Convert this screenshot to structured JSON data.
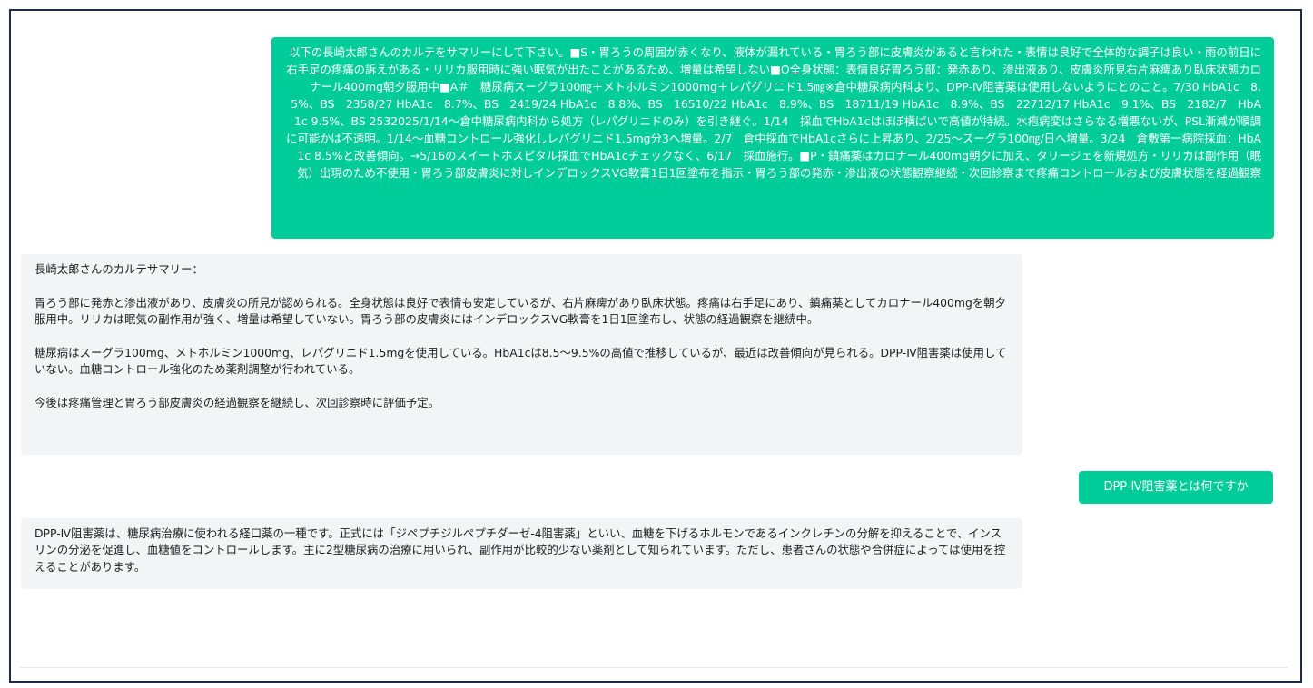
{
  "conversation": {
    "messages": [
      {
        "role": "user",
        "text": "以下の長崎太郎さんのカルテをサマリーにして下さい。■S・胃ろうの周囲が赤くなり、液体が漏れている・胃ろう部に皮膚炎があると言われた・表情は良好で全体的な調子は良い・雨の前日に右手足の疼痛の訴えがある・リリカ服用時に強い眠気が出たことがあるため、増量は希望しない■O全身状態：表情良好胃ろう部：発赤あり、滲出液あり、皮膚炎所見右片麻痺あり臥床状態カロナール400mg朝夕服用中■A＃　糖尿病スーグラ100㎎＋メトホルミン1000mg＋レパグリニド1.5㎎※倉中糖尿病内科より、DPP-Ⅳ阻害薬は使用しないようにとのこと。7/30 HbA1c　8.5%、BS　2358/27 HbA1c　8.7%、BS　2419/24 HbA1c　8.8%、BS　16510/22 HbA1c　8.9%、BS　18711/19 HbA1c　8.9%、BS　22712/17 HbA1c　9.1%、BS　2182/7　HbA1c 9.5%、BS 2532025/1/14～倉中糖尿病内科から処方（レパグリニドのみ）を引き継ぐ。1/14　採血でHbA1cはほぼ横ばいで高値が持続。水疱病変はさらなる増悪ないが、PSL漸減が順調に可能かは不透明。1/14～血糖コントロール強化しレパグリニド1.5mg分3へ増量。2/7　倉中採血でHbA1cさらに上昇あり、2/25～スーグラ100㎎/日へ増量。3/24　倉敷第一病院採血：HbA1c 8.5%と改善傾向。→5/16のスイートホスピタル採血でHbA1cチェックなく、6/17　採血施行。■P・鎮痛薬はカロナール400mg朝夕に加え、タリージェを新規処方・リリカは副作用（眠気）出現のため不使用・胃ろう部皮膚炎に対しインデロックスVG軟膏1日1回塗布を指示・胃ろう部の発赤・滲出液の状態観察継続・次回診察まで疼痛コントロールおよび皮膚状態を経過観察"
      },
      {
        "role": "assistant",
        "text": "長崎太郎さんのカルテサマリー：\n\n胃ろう部に発赤と滲出液があり、皮膚炎の所見が認められる。全身状態は良好で表情も安定しているが、右片麻痺があり臥床状態。疼痛は右手足にあり、鎮痛薬としてカロナール400mgを朝夕服用中。リリカは眠気の副作用が強く、増量は希望していない。胃ろう部の皮膚炎にはインデロックスVG軟膏を1日1回塗布し、状態の経過観察を継続中。\n\n糖尿病はスーグラ100mg、メトホルミン1000mg、レパグリニド1.5mgを使用している。HbA1cは8.5～9.5%の高値で推移しているが、最近は改善傾向が見られる。DPP-Ⅳ阻害薬は使用していない。血糖コントロール強化のため薬剤調整が行われている。\n\n今後は疼痛管理と胃ろう部皮膚炎の経過観察を継続し、次回診察時に評価予定。"
      },
      {
        "role": "user",
        "text": "DPP-Ⅳ阻害薬とは何ですか"
      },
      {
        "role": "assistant",
        "text": "DPP-Ⅳ阻害薬は、糖尿病治療に使われる経口薬の一種です。正式には「ジペプチジルペプチダーゼ-4阻害薬」といい、血糖を下げるホルモンであるインクレチンの分解を抑えることで、インスリンの分泌を促進し、血糖値をコントロールします。主に2型糖尿病の治療に用いられ、副作用が比較的少ない薬剤として知られています。ただし、患者さんの状態や合併症によっては使用を控えることがあります。"
      }
    ]
  },
  "colors": {
    "user_bubble": "#00cc99",
    "assistant_bubble": "#f3f4f6",
    "frame_border": "#1f2a44"
  }
}
